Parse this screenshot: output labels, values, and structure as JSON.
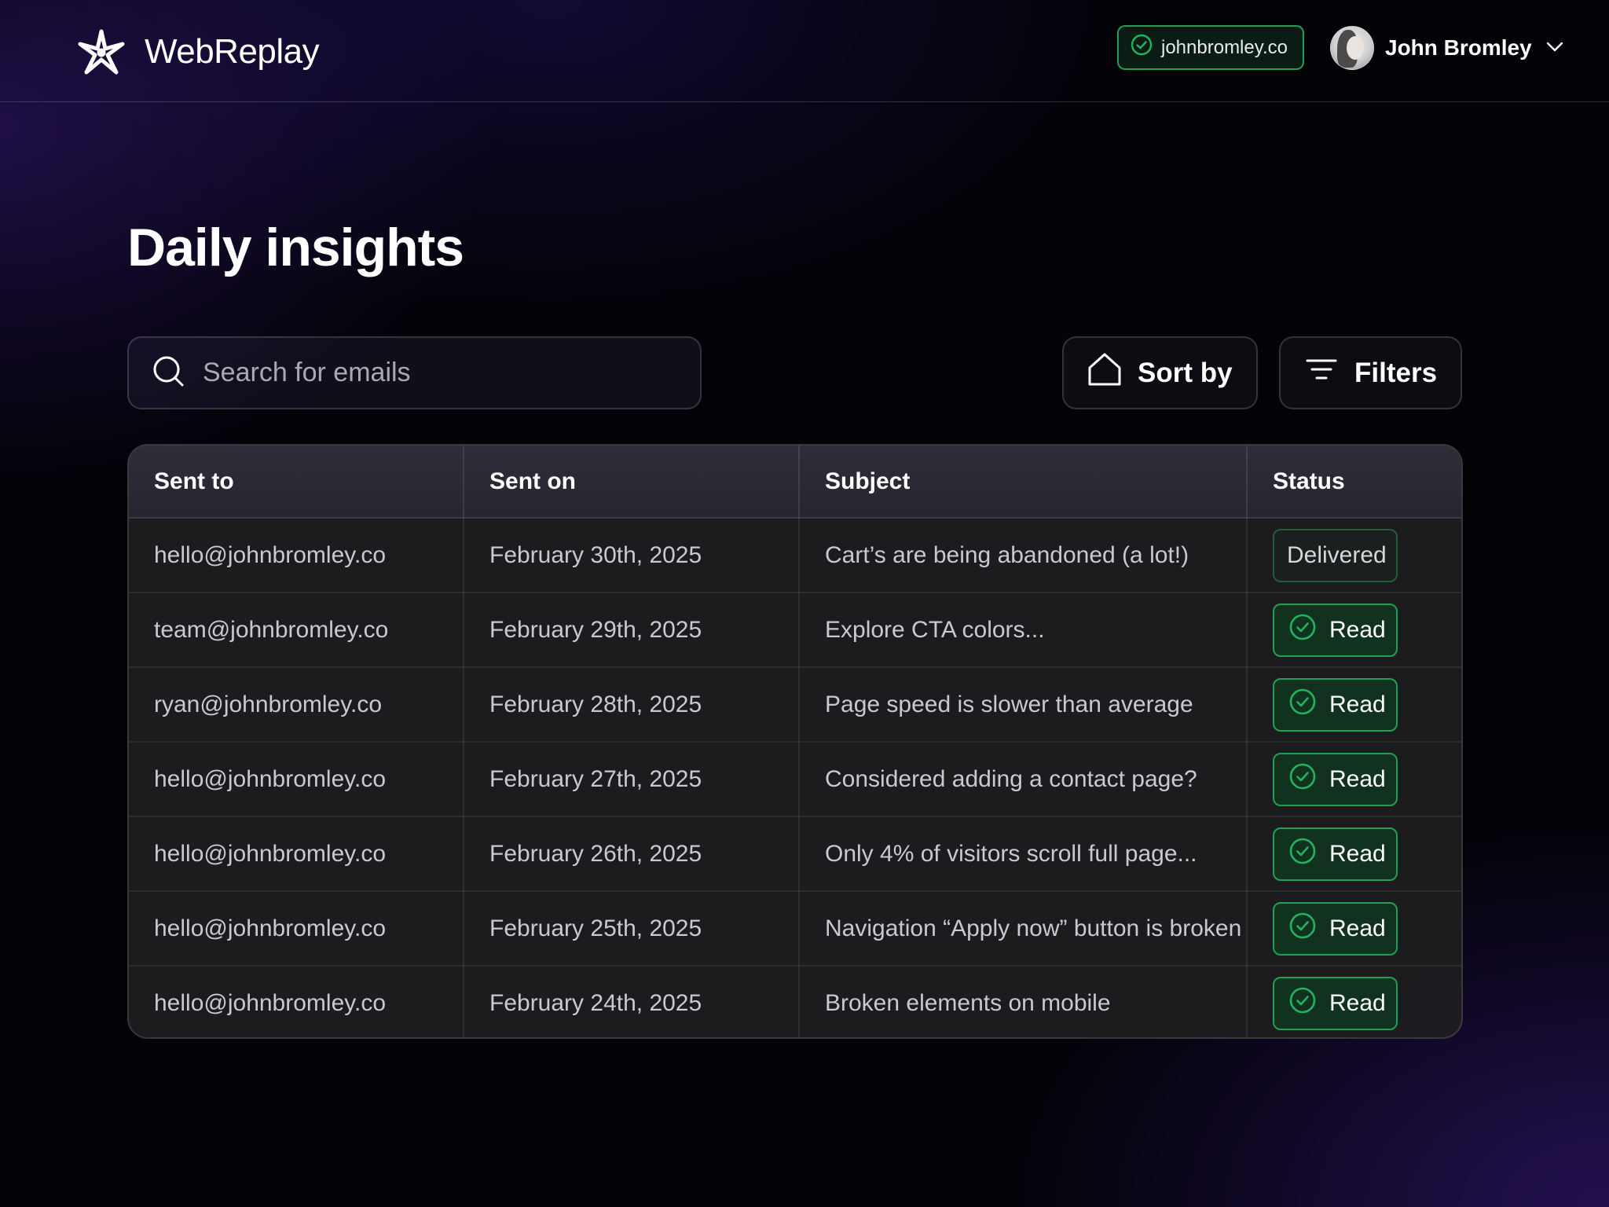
{
  "app": {
    "brand_name": "WebReplay",
    "logo_icon": "asterisk-logo-icon"
  },
  "header": {
    "domain": "johnbromley.co",
    "domain_icon": "check-circle-icon",
    "user_name": "John Bromley",
    "user_menu_icon": "chevron-down-icon"
  },
  "page": {
    "title": "Daily insights"
  },
  "search": {
    "placeholder": "Search for emails",
    "value": "",
    "icon": "search-icon"
  },
  "toolbar": {
    "sort_label": "Sort by",
    "sort_icon": "home-icon",
    "filters_label": "Filters",
    "filters_icon": "filter-lines-icon"
  },
  "table": {
    "columns": [
      "Sent to",
      "Sent on",
      "Subject",
      "Status"
    ],
    "rows": [
      {
        "sent_to": "hello@johnbromley.co",
        "sent_on": "February 30th, 2025",
        "subject": "Cart’s are being abandoned (a lot!)",
        "status": "Delivered"
      },
      {
        "sent_to": "team@johnbromley.co",
        "sent_on": "February 29th, 2025",
        "subject": "Explore CTA colors...",
        "status": "Read"
      },
      {
        "sent_to": "ryan@johnbromley.co",
        "sent_on": "February 28th, 2025",
        "subject": "Page speed is slower than average",
        "status": "Read"
      },
      {
        "sent_to": "hello@johnbromley.co",
        "sent_on": "February 27th, 2025",
        "subject": "Considered adding a contact page?",
        "status": "Read"
      },
      {
        "sent_to": "hello@johnbromley.co",
        "sent_on": "February 26th, 2025",
        "subject": "Only 4% of visitors scroll full page...",
        "status": "Read"
      },
      {
        "sent_to": "hello@johnbromley.co",
        "sent_on": "February 25th, 2025",
        "subject": "Navigation “Apply now” button is broken",
        "status": "Read"
      },
      {
        "sent_to": "hello@johnbromley.co",
        "sent_on": "February 24th, 2025",
        "subject": "Broken elements on mobile",
        "status": "Read"
      }
    ]
  },
  "colors": {
    "accent_green": "#1fa055",
    "background": "#030207",
    "gradient_purple": "#341878"
  }
}
